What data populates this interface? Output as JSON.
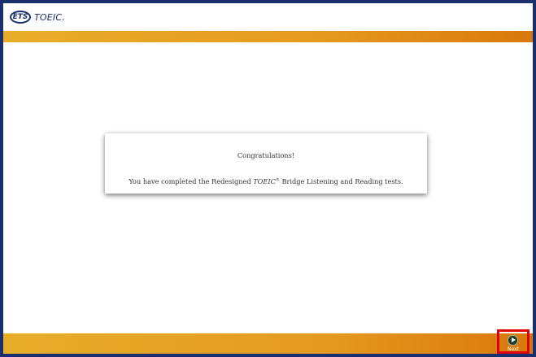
{
  "header": {
    "logo_badge": "ETS",
    "logo_text": "TOEIC."
  },
  "dialog": {
    "title": "Congratulations!",
    "message_prefix": "You have completed the Redesigned ",
    "message_brand": "TOEIC",
    "message_reg": "®",
    "message_suffix": " Bridge Listening and Reading tests."
  },
  "footer": {
    "next_label": "Next"
  },
  "colors": {
    "frame": "#1a2f6e",
    "band_start": "#e8ad2b",
    "band_end": "#d9780d",
    "highlight": "#e00000"
  },
  "icons": {
    "next": "play-circle-icon"
  }
}
